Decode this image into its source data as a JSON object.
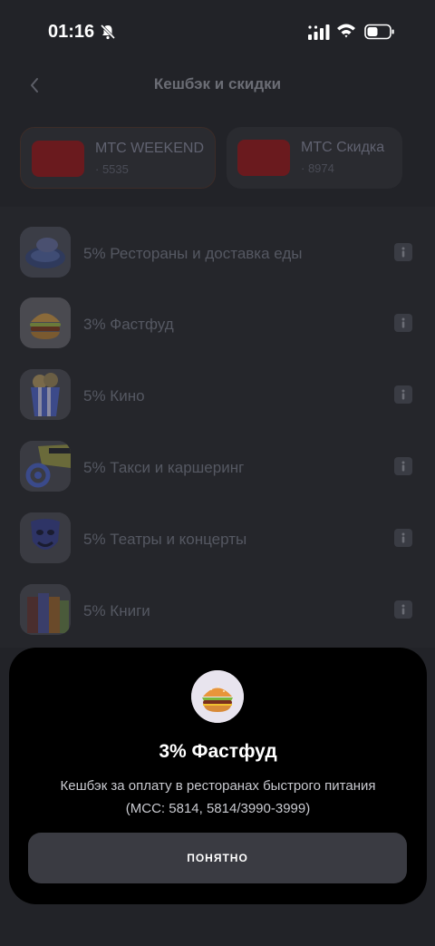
{
  "status_bar": {
    "time": "01:16",
    "icons": [
      "bell-slash-icon",
      "signal-icon",
      "wifi-icon",
      "battery-icon"
    ]
  },
  "header": {
    "back_icon": "chevron-left-icon",
    "title": "Кешбэк и скидки"
  },
  "cards": [
    {
      "name": "МТС WEEKEND",
      "number": "· 5535"
    },
    {
      "name": "МТС Скидка",
      "number": "· 8974"
    }
  ],
  "categories": [
    {
      "label": "5% Рестораны и доставка еды",
      "icon": "restaurant-plate-icon"
    },
    {
      "label": "3% Фастфуд",
      "icon": "burger-icon"
    },
    {
      "label": "5% Кино",
      "icon": "popcorn-icon"
    },
    {
      "label": "5% Такси и каршеринг",
      "icon": "car-icon"
    },
    {
      "label": "5% Театры и концерты",
      "icon": "theatre-mask-icon"
    },
    {
      "label": "5% Книги",
      "icon": "books-icon"
    }
  ],
  "sheet": {
    "icon": "burger-icon",
    "title": "3% Фастфуд",
    "description_line1": "Кешбэк за оплату в ресторанах быстрого питания",
    "description_line2": "(MCC: 5814, 5814/3990-3999)",
    "button_label": "ПОНЯТНО"
  },
  "colors": {
    "card_accent": "#6a1a1e",
    "sheet_background": "#000000",
    "button_background": "#3a3b42"
  }
}
